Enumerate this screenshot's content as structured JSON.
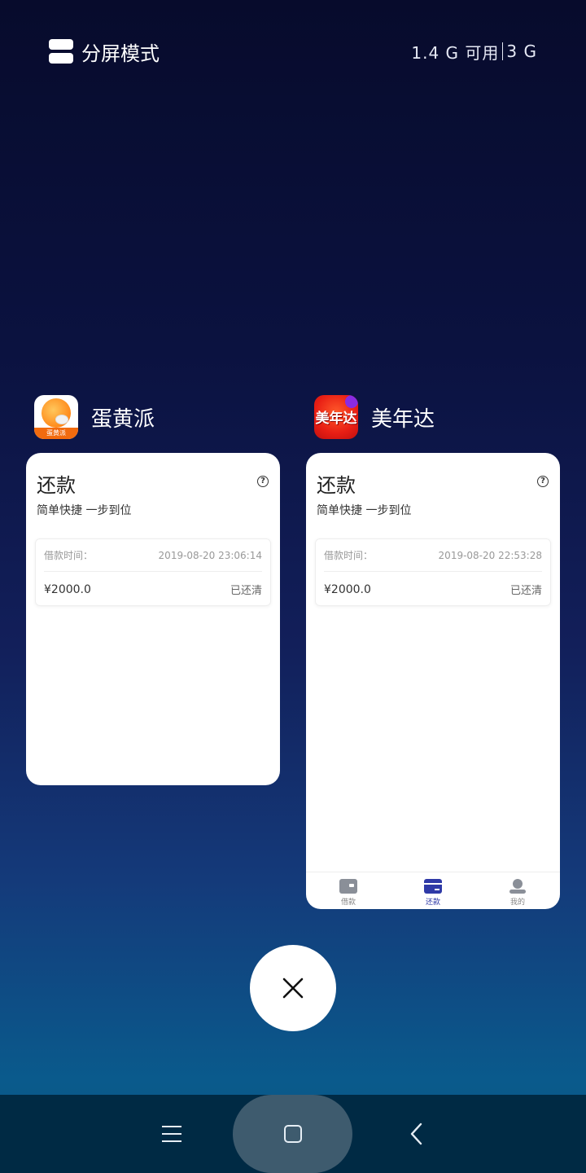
{
  "topbar": {
    "split_label": "分屏模式",
    "mem_available": "1.4 G 可用",
    "mem_total": "3 G"
  },
  "apps": [
    {
      "name": "蛋黄派",
      "icon": "egg-yolk-sun-icon",
      "icon_band_text": "蛋黄派",
      "card": {
        "title": "还款",
        "subtitle": "简单快捷  一步到位",
        "record": {
          "time_label": "借款时间：",
          "time_value": "2019-08-20 23:06:14",
          "amount": "¥2000.0",
          "status": "已还清"
        }
      }
    },
    {
      "name": "美年达",
      "icon": "meinianda-logo-icon",
      "icon_text": "美年达",
      "card": {
        "title": "还款",
        "subtitle": "简单快捷  一步到位",
        "record": {
          "time_label": "借款时间：",
          "time_value": "2019-08-20 22:53:28",
          "amount": "¥2000.0",
          "status": "已还清"
        },
        "tabs": [
          {
            "label": "借款",
            "icon": "wallet-icon",
            "active": false
          },
          {
            "label": "还款",
            "icon": "card-icon",
            "active": true
          },
          {
            "label": "我的",
            "icon": "user-icon",
            "active": false
          }
        ]
      }
    }
  ],
  "colors": {
    "accent": "#2f3aa7",
    "navbar": "#002a44"
  }
}
